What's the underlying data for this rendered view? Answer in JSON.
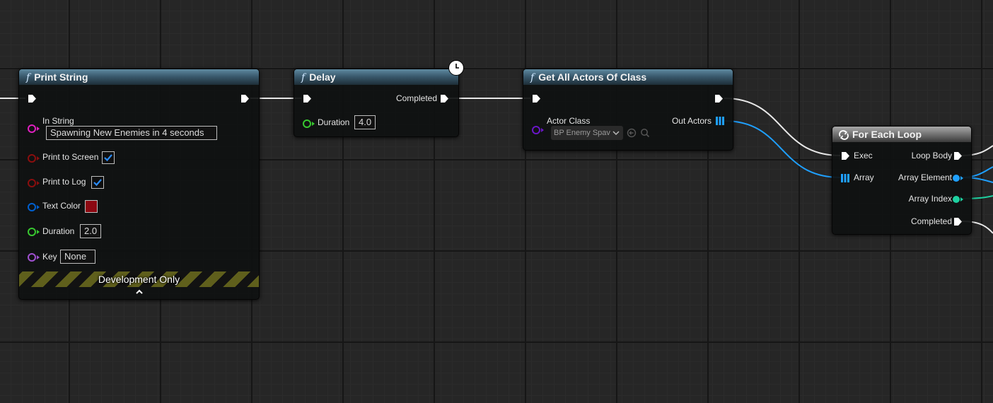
{
  "colors": {
    "exec": "#ffffff",
    "string": "#e020c0",
    "bool": "#8a0e0e",
    "struct": "#0060d0",
    "float": "#38c830",
    "name": "#a050d0",
    "class": "#6a16c8",
    "object_array": "#1fa0ff",
    "int": "#1ed0a0",
    "link_color": "#8c0812"
  },
  "print_string": {
    "title": "Print String",
    "pins": {
      "in_string": {
        "label": "In String",
        "value": "Spawning New Enemies in 4 seconds"
      },
      "print_to_screen": {
        "label": "Print to Screen",
        "checked": true
      },
      "print_to_log": {
        "label": "Print to Log",
        "checked": true
      },
      "text_color": {
        "label": "Text Color",
        "value": "#8c0812"
      },
      "duration": {
        "label": "Duration",
        "value": "2.0"
      },
      "key": {
        "label": "Key",
        "value": "None"
      }
    },
    "footer": "Development Only"
  },
  "delay": {
    "title": "Delay",
    "completed_label": "Completed",
    "duration_label": "Duration",
    "duration_value": "4.0",
    "icon": "clock-icon"
  },
  "get_all_actors": {
    "title": "Get All Actors Of Class",
    "actor_class_label": "Actor Class",
    "actor_class_value": "BP Enemy Spav",
    "out_actors_label": "Out Actors"
  },
  "for_each": {
    "title": "For Each Loop",
    "exec_label": "Exec",
    "array_label": "Array",
    "loop_body_label": "Loop Body",
    "array_element_label": "Array Element",
    "array_index_label": "Array Index",
    "completed_label": "Completed"
  }
}
